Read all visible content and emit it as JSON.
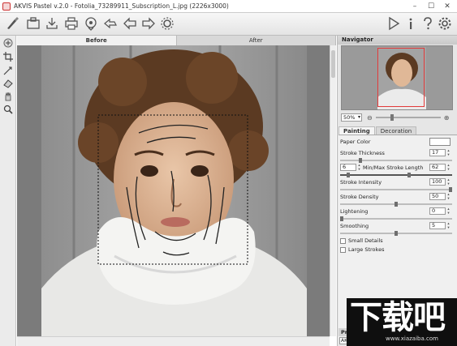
{
  "window": {
    "title": "AKVIS Pastel v.2.0 - Fotolia_73289911_Subscription_L.jpg (2226x3000)",
    "minimize_label": "–",
    "maximize_label": "☐",
    "close_label": "✕"
  },
  "toolbar": {
    "left_icons": [
      "brush-logo-icon",
      "open-icon",
      "save-icon",
      "print-icon",
      "share-icon",
      "batch-icon",
      "undo-icon",
      "redo-icon",
      "settings-gear-icon"
    ],
    "right_icons": [
      "run-icon",
      "info-icon",
      "help-icon",
      "preferences-icon"
    ]
  },
  "left_tools": [
    "hand-icon",
    "crop-icon",
    "stroke-direction-icon",
    "eraser-icon",
    "pan-icon",
    "zoom-icon"
  ],
  "view_tabs": {
    "before": "Before",
    "after": "After"
  },
  "navigator": {
    "title": "Navigator",
    "zoom": "50%",
    "zoom_out": "⊖",
    "zoom_in": "⊕"
  },
  "panel": {
    "tabs": [
      "Painting",
      "Decoration"
    ],
    "paper_color_label": "Paper Color",
    "params": [
      {
        "label": "Stroke Thickness",
        "value": "17",
        "level": 0.17
      },
      {
        "label": "Min/Max Stroke Length",
        "min_value": "6",
        "max_value": "62",
        "level_min": 0.06,
        "level_max": 0.62
      },
      {
        "label": "Stroke Intensity",
        "value": "100",
        "level": 1.0
      },
      {
        "label": "Stroke Density",
        "value": "50",
        "level": 0.5
      },
      {
        "label": "Lightening",
        "value": "0",
        "level": 0.0
      },
      {
        "label": "Smoothing",
        "value": "5",
        "level": 0.5
      }
    ],
    "checkboxes": [
      {
        "label": "Small Details",
        "checked": false
      },
      {
        "label": "Large Strokes",
        "checked": false
      }
    ],
    "presets_label": "Pr",
    "presets_value": "AK"
  },
  "watermark": {
    "text": "下载吧",
    "url": "www.xiazaiba.com"
  }
}
